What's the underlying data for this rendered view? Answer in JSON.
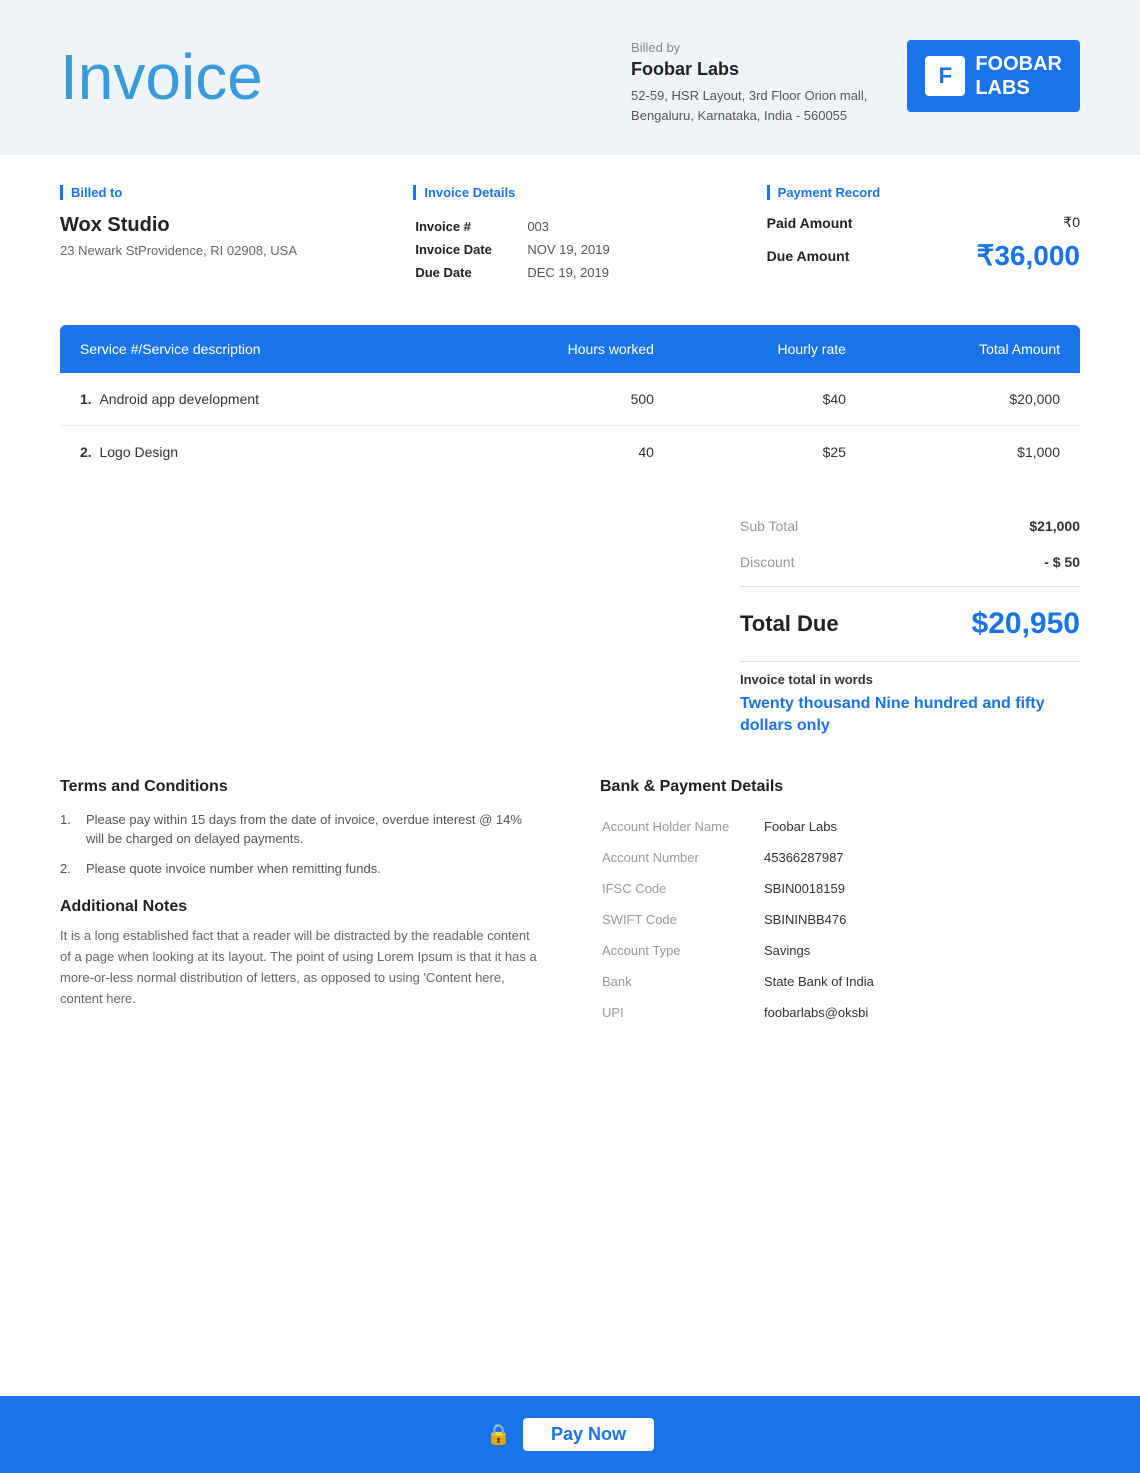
{
  "header": {
    "title": "Invoice",
    "billed_by": {
      "label": "Billed by",
      "name": "Foobar Labs",
      "address_line1": "52-59, HSR Layout, 3rd Floor Orion mall,",
      "address_line2": "Bengaluru, Karnataka, India - 560055"
    },
    "logo": {
      "icon_letter": "F",
      "name_line1": "FOOBAR",
      "name_line2": "LABS"
    }
  },
  "billed_to": {
    "section_label": "Billed to",
    "name": "Wox Studio",
    "address": "23 Newark StProvidence, RI 02908, USA"
  },
  "invoice_details": {
    "section_label": "Invoice Details",
    "fields": [
      {
        "label": "Invoice #",
        "value": "003"
      },
      {
        "label": "Invoice Date",
        "value": "NOV 19, 2019"
      },
      {
        "label": "Due Date",
        "value": "DEC 19, 2019"
      }
    ]
  },
  "payment_record": {
    "section_label": "Payment Record",
    "paid_label": "Paid Amount",
    "paid_value": "₹0",
    "due_label": "Due Amount",
    "due_value": "₹36,000"
  },
  "services_table": {
    "headers": {
      "service": "Service #/Service description",
      "hours": "Hours worked",
      "rate": "Hourly rate",
      "total": "Total Amount"
    },
    "rows": [
      {
        "num": "1.",
        "description": "Android app development",
        "hours": "500",
        "rate": "$40",
        "total": "$20,000"
      },
      {
        "num": "2.",
        "description": "Logo Design",
        "hours": "40",
        "rate": "$25",
        "total": "$1,000"
      }
    ]
  },
  "totals": {
    "subtotal_label": "Sub Total",
    "subtotal_value": "$21,000",
    "discount_label": "Discount",
    "discount_value": "- $ 50",
    "total_due_label": "Total Due",
    "total_due_value": "$20,950",
    "words_label": "Invoice total in words",
    "words_value": "Twenty thousand Nine hundred and fifty dollars only"
  },
  "terms": {
    "title": "Terms and Conditions",
    "items": [
      "Please pay within 15 days from the date of invoice, overdue interest @ 14% will be charged on delayed payments.",
      "Please quote invoice number when remitting funds."
    ],
    "notes_title": "Additional Notes",
    "notes_text": "It is a long established fact that a reader will be distracted by the readable content of a page when looking at its layout. The point of using Lorem Ipsum is that it has a more-or-less normal distribution of letters, as opposed to using 'Content here, content here."
  },
  "bank": {
    "title": "Bank & Payment Details",
    "fields": [
      {
        "label": "Account Holder Name",
        "value": "Foobar Labs"
      },
      {
        "label": "Account Number",
        "value": "45366287987"
      },
      {
        "label": "IFSC Code",
        "value": "SBIN0018159"
      },
      {
        "label": "SWIFT Code",
        "value": "SBININBB476"
      },
      {
        "label": "Account Type",
        "value": "Savings"
      },
      {
        "label": "Bank",
        "value": "State Bank of India"
      },
      {
        "label": "UPI",
        "value": "foobarlabs@oksbi"
      }
    ]
  },
  "footer": {
    "pay_label": "Pay Now"
  }
}
